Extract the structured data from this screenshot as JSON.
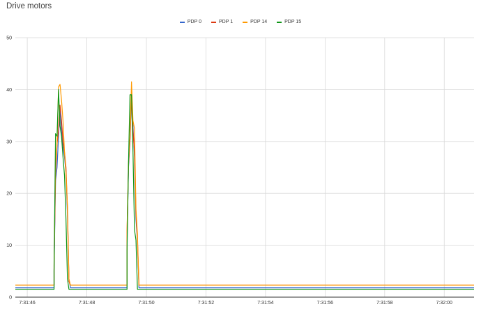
{
  "chart_data": {
    "type": "line",
    "title": "Drive motors",
    "xlabel": "",
    "ylabel": "",
    "ylim": [
      0,
      50
    ],
    "yticks": [
      0,
      10,
      20,
      30,
      40,
      50
    ],
    "xlim": [
      "7:31:45.6",
      "7:32:01.0"
    ],
    "xtick_labels": [
      "7:31:46",
      "7:31:48",
      "7:31:50",
      "7:31:52",
      "7:31:54",
      "7:31:56",
      "7:31:58",
      "7:32:00"
    ],
    "grid": true,
    "legend_position": "top",
    "series": [
      {
        "name": "PDP 0",
        "color": "#3366cc",
        "points": [
          [
            "7:31:45.6",
            1.8
          ],
          [
            "7:31:46.9",
            1.8
          ],
          [
            "7:31:46.9",
            5.2
          ],
          [
            "7:31:46.95",
            22.5
          ],
          [
            "7:31:47.0",
            25.0
          ],
          [
            "7:31:47.05",
            31.0
          ],
          [
            "7:31:47.1",
            36.0
          ],
          [
            "7:31:47.15",
            32.0
          ],
          [
            "7:31:47.2",
            29.0
          ],
          [
            "7:31:47.25",
            27.0
          ],
          [
            "7:31:47.3",
            24.0
          ],
          [
            "7:31:47.35",
            16.0
          ],
          [
            "7:31:47.4",
            3.5
          ],
          [
            "7:31:47.45",
            1.8
          ],
          [
            "7:31:49.35",
            1.8
          ],
          [
            "7:31:49.35",
            11.0
          ],
          [
            "7:31:49.4",
            25.0
          ],
          [
            "7:31:49.45",
            30.0
          ],
          [
            "7:31:49.5",
            38.5
          ],
          [
            "7:31:49.55",
            33.0
          ],
          [
            "7:31:49.6",
            27.0
          ],
          [
            "7:31:49.65",
            15.0
          ],
          [
            "7:31:49.7",
            11.0
          ],
          [
            "7:31:49.75",
            1.8
          ],
          [
            "7:32:01.0",
            1.8
          ]
        ]
      },
      {
        "name": "PDP 1",
        "color": "#dc3912",
        "points": [
          [
            "7:31:45.6",
            2.3
          ],
          [
            "7:31:46.9",
            2.3
          ],
          [
            "7:31:46.9",
            6.0
          ],
          [
            "7:31:46.95",
            24.0
          ],
          [
            "7:31:47.0",
            29.5
          ],
          [
            "7:31:47.05",
            32.0
          ],
          [
            "7:31:47.1",
            37.0
          ],
          [
            "7:31:47.15",
            34.0
          ],
          [
            "7:31:47.2",
            30.0
          ],
          [
            "7:31:47.25",
            28.0
          ],
          [
            "7:31:47.3",
            25.0
          ],
          [
            "7:31:47.35",
            17.0
          ],
          [
            "7:31:47.4",
            3.0
          ],
          [
            "7:31:47.45",
            2.3
          ],
          [
            "7:31:49.35",
            2.3
          ],
          [
            "7:31:49.35",
            12.5
          ],
          [
            "7:31:49.4",
            25.5
          ],
          [
            "7:31:49.45",
            30.5
          ],
          [
            "7:31:49.5",
            39.0
          ],
          [
            "7:31:49.55",
            32.0
          ],
          [
            "7:31:49.6",
            28.0
          ],
          [
            "7:31:49.65",
            16.0
          ],
          [
            "7:31:49.7",
            11.0
          ],
          [
            "7:31:49.75",
            2.3
          ],
          [
            "7:32:01.0",
            2.3
          ]
        ]
      },
      {
        "name": "PDP 14",
        "color": "#ff9900",
        "points": [
          [
            "7:31:45.6",
            2.3
          ],
          [
            "7:31:46.9",
            2.3
          ],
          [
            "7:31:46.9",
            6.5
          ],
          [
            "7:31:46.95",
            26.0
          ],
          [
            "7:31:47.0",
            29.5
          ],
          [
            "7:31:47.05",
            40.5
          ],
          [
            "7:31:47.1",
            41.0
          ],
          [
            "7:31:47.15",
            38.0
          ],
          [
            "7:31:47.2",
            34.0
          ],
          [
            "7:31:47.25",
            28.0
          ],
          [
            "7:31:47.3",
            24.0
          ],
          [
            "7:31:47.35",
            17.5
          ],
          [
            "7:31:47.4",
            3.5
          ],
          [
            "7:31:47.45",
            2.3
          ],
          [
            "7:31:49.35",
            2.3
          ],
          [
            "7:31:49.35",
            13.0
          ],
          [
            "7:31:49.4",
            26.0
          ],
          [
            "7:31:49.45",
            31.0
          ],
          [
            "7:31:49.5",
            41.5
          ],
          [
            "7:31:49.55",
            34.0
          ],
          [
            "7:31:49.6",
            32.5
          ],
          [
            "7:31:49.65",
            17.0
          ],
          [
            "7:31:49.7",
            12.0
          ],
          [
            "7:31:49.75",
            2.3
          ],
          [
            "7:32:01.0",
            2.3
          ]
        ]
      },
      {
        "name": "PDP 15",
        "color": "#109618",
        "points": [
          [
            "7:31:45.6",
            1.5
          ],
          [
            "7:31:46.9",
            1.5
          ],
          [
            "7:31:46.9",
            5.0
          ],
          [
            "7:31:46.95",
            31.5
          ],
          [
            "7:31:47.0",
            31.0
          ],
          [
            "7:31:47.05",
            40.0
          ],
          [
            "7:31:47.1",
            33.0
          ],
          [
            "7:31:47.15",
            31.0
          ],
          [
            "7:31:47.2",
            27.0
          ],
          [
            "7:31:47.25",
            23.5
          ],
          [
            "7:31:47.3",
            15.0
          ],
          [
            "7:31:47.35",
            3.5
          ],
          [
            "7:31:47.4",
            1.5
          ],
          [
            "7:31:49.35",
            1.5
          ],
          [
            "7:31:49.35",
            9.0
          ],
          [
            "7:31:49.4",
            26.0
          ],
          [
            "7:31:49.45",
            39.0
          ],
          [
            "7:31:49.5",
            39.0
          ],
          [
            "7:31:49.55",
            28.0
          ],
          [
            "7:31:49.6",
            13.0
          ],
          [
            "7:31:49.65",
            11.0
          ],
          [
            "7:31:49.7",
            1.5
          ],
          [
            "7:32:01.0",
            1.5
          ]
        ]
      }
    ]
  }
}
